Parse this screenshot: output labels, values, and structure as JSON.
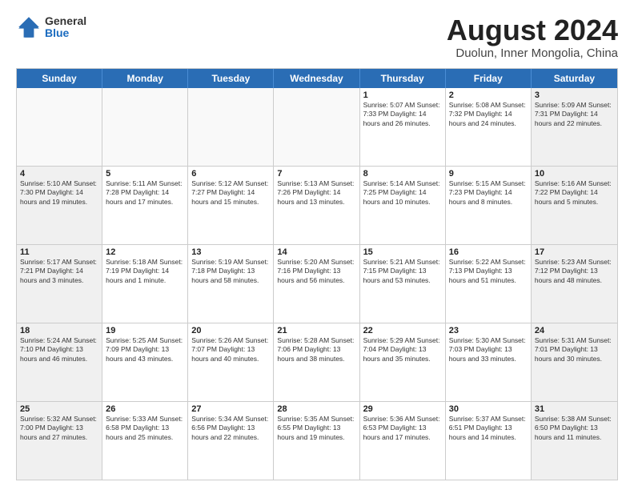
{
  "header": {
    "logo_general": "General",
    "logo_blue": "Blue",
    "title": "August 2024",
    "subtitle": "Duolun, Inner Mongolia, China"
  },
  "days_of_week": [
    "Sunday",
    "Monday",
    "Tuesday",
    "Wednesday",
    "Thursday",
    "Friday",
    "Saturday"
  ],
  "weeks": [
    [
      {
        "day": "",
        "text": "",
        "shaded": false,
        "empty": true
      },
      {
        "day": "",
        "text": "",
        "shaded": false,
        "empty": true
      },
      {
        "day": "",
        "text": "",
        "shaded": false,
        "empty": true
      },
      {
        "day": "",
        "text": "",
        "shaded": false,
        "empty": true
      },
      {
        "day": "1",
        "text": "Sunrise: 5:07 AM\nSunset: 7:33 PM\nDaylight: 14 hours\nand 26 minutes.",
        "shaded": false,
        "empty": false
      },
      {
        "day": "2",
        "text": "Sunrise: 5:08 AM\nSunset: 7:32 PM\nDaylight: 14 hours\nand 24 minutes.",
        "shaded": false,
        "empty": false
      },
      {
        "day": "3",
        "text": "Sunrise: 5:09 AM\nSunset: 7:31 PM\nDaylight: 14 hours\nand 22 minutes.",
        "shaded": true,
        "empty": false
      }
    ],
    [
      {
        "day": "4",
        "text": "Sunrise: 5:10 AM\nSunset: 7:30 PM\nDaylight: 14 hours\nand 19 minutes.",
        "shaded": true,
        "empty": false
      },
      {
        "day": "5",
        "text": "Sunrise: 5:11 AM\nSunset: 7:28 PM\nDaylight: 14 hours\nand 17 minutes.",
        "shaded": false,
        "empty": false
      },
      {
        "day": "6",
        "text": "Sunrise: 5:12 AM\nSunset: 7:27 PM\nDaylight: 14 hours\nand 15 minutes.",
        "shaded": false,
        "empty": false
      },
      {
        "day": "7",
        "text": "Sunrise: 5:13 AM\nSunset: 7:26 PM\nDaylight: 14 hours\nand 13 minutes.",
        "shaded": false,
        "empty": false
      },
      {
        "day": "8",
        "text": "Sunrise: 5:14 AM\nSunset: 7:25 PM\nDaylight: 14 hours\nand 10 minutes.",
        "shaded": false,
        "empty": false
      },
      {
        "day": "9",
        "text": "Sunrise: 5:15 AM\nSunset: 7:23 PM\nDaylight: 14 hours\nand 8 minutes.",
        "shaded": false,
        "empty": false
      },
      {
        "day": "10",
        "text": "Sunrise: 5:16 AM\nSunset: 7:22 PM\nDaylight: 14 hours\nand 5 minutes.",
        "shaded": true,
        "empty": false
      }
    ],
    [
      {
        "day": "11",
        "text": "Sunrise: 5:17 AM\nSunset: 7:21 PM\nDaylight: 14 hours\nand 3 minutes.",
        "shaded": true,
        "empty": false
      },
      {
        "day": "12",
        "text": "Sunrise: 5:18 AM\nSunset: 7:19 PM\nDaylight: 14 hours\nand 1 minute.",
        "shaded": false,
        "empty": false
      },
      {
        "day": "13",
        "text": "Sunrise: 5:19 AM\nSunset: 7:18 PM\nDaylight: 13 hours\nand 58 minutes.",
        "shaded": false,
        "empty": false
      },
      {
        "day": "14",
        "text": "Sunrise: 5:20 AM\nSunset: 7:16 PM\nDaylight: 13 hours\nand 56 minutes.",
        "shaded": false,
        "empty": false
      },
      {
        "day": "15",
        "text": "Sunrise: 5:21 AM\nSunset: 7:15 PM\nDaylight: 13 hours\nand 53 minutes.",
        "shaded": false,
        "empty": false
      },
      {
        "day": "16",
        "text": "Sunrise: 5:22 AM\nSunset: 7:13 PM\nDaylight: 13 hours\nand 51 minutes.",
        "shaded": false,
        "empty": false
      },
      {
        "day": "17",
        "text": "Sunrise: 5:23 AM\nSunset: 7:12 PM\nDaylight: 13 hours\nand 48 minutes.",
        "shaded": true,
        "empty": false
      }
    ],
    [
      {
        "day": "18",
        "text": "Sunrise: 5:24 AM\nSunset: 7:10 PM\nDaylight: 13 hours\nand 46 minutes.",
        "shaded": true,
        "empty": false
      },
      {
        "day": "19",
        "text": "Sunrise: 5:25 AM\nSunset: 7:09 PM\nDaylight: 13 hours\nand 43 minutes.",
        "shaded": false,
        "empty": false
      },
      {
        "day": "20",
        "text": "Sunrise: 5:26 AM\nSunset: 7:07 PM\nDaylight: 13 hours\nand 40 minutes.",
        "shaded": false,
        "empty": false
      },
      {
        "day": "21",
        "text": "Sunrise: 5:28 AM\nSunset: 7:06 PM\nDaylight: 13 hours\nand 38 minutes.",
        "shaded": false,
        "empty": false
      },
      {
        "day": "22",
        "text": "Sunrise: 5:29 AM\nSunset: 7:04 PM\nDaylight: 13 hours\nand 35 minutes.",
        "shaded": false,
        "empty": false
      },
      {
        "day": "23",
        "text": "Sunrise: 5:30 AM\nSunset: 7:03 PM\nDaylight: 13 hours\nand 33 minutes.",
        "shaded": false,
        "empty": false
      },
      {
        "day": "24",
        "text": "Sunrise: 5:31 AM\nSunset: 7:01 PM\nDaylight: 13 hours\nand 30 minutes.",
        "shaded": true,
        "empty": false
      }
    ],
    [
      {
        "day": "25",
        "text": "Sunrise: 5:32 AM\nSunset: 7:00 PM\nDaylight: 13 hours\nand 27 minutes.",
        "shaded": true,
        "empty": false
      },
      {
        "day": "26",
        "text": "Sunrise: 5:33 AM\nSunset: 6:58 PM\nDaylight: 13 hours\nand 25 minutes.",
        "shaded": false,
        "empty": false
      },
      {
        "day": "27",
        "text": "Sunrise: 5:34 AM\nSunset: 6:56 PM\nDaylight: 13 hours\nand 22 minutes.",
        "shaded": false,
        "empty": false
      },
      {
        "day": "28",
        "text": "Sunrise: 5:35 AM\nSunset: 6:55 PM\nDaylight: 13 hours\nand 19 minutes.",
        "shaded": false,
        "empty": false
      },
      {
        "day": "29",
        "text": "Sunrise: 5:36 AM\nSunset: 6:53 PM\nDaylight: 13 hours\nand 17 minutes.",
        "shaded": false,
        "empty": false
      },
      {
        "day": "30",
        "text": "Sunrise: 5:37 AM\nSunset: 6:51 PM\nDaylight: 13 hours\nand 14 minutes.",
        "shaded": false,
        "empty": false
      },
      {
        "day": "31",
        "text": "Sunrise: 5:38 AM\nSunset: 6:50 PM\nDaylight: 13 hours\nand 11 minutes.",
        "shaded": true,
        "empty": false
      }
    ]
  ]
}
